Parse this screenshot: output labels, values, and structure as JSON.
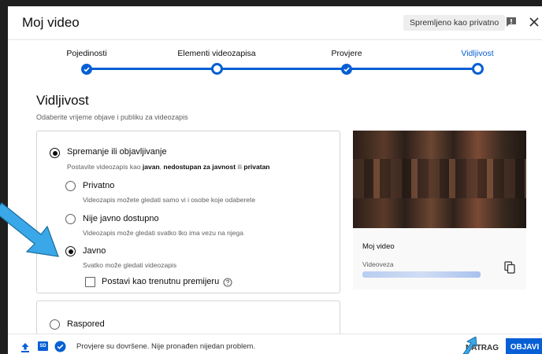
{
  "header": {
    "title": "Moj video",
    "saved_status": "Spremljeno kao privatno"
  },
  "steps": [
    {
      "label": "Pojedinosti",
      "state": "done"
    },
    {
      "label": "Elementi videozapisa",
      "state": "current"
    },
    {
      "label": "Provjere",
      "state": "done"
    },
    {
      "label": "Vidljivost",
      "state": "active"
    }
  ],
  "section": {
    "title": "Vidljivost",
    "subtitle": "Odaberite vrijeme objave i publiku za videozapis"
  },
  "save_publish": {
    "label": "Spremanje ili objavljivanje",
    "desc_parts": [
      "Postavite videozapis kao ",
      "javan",
      ", ",
      "nedostupan za javnost",
      " ili ",
      "privatan"
    ]
  },
  "options": [
    {
      "label": "Privatno",
      "desc": "Videozapis možete gledati samo vi i osobe koje odaberete",
      "selected": false
    },
    {
      "label": "Nije javno dostupno",
      "desc": "Videozapis može gledati svatko tko ima vezu na njega",
      "selected": false
    },
    {
      "label": "Javno",
      "desc": "Svatko može gledati videozapis",
      "selected": true
    }
  ],
  "premiere": {
    "label": "Postavi kao trenutnu premijeru",
    "checked": false
  },
  "schedule": {
    "label": "Raspored"
  },
  "preview": {
    "title": "Moj video",
    "link_label": "Videoveza"
  },
  "footer": {
    "hd_badge": "SD",
    "status": "Provjere su dovršene. Nije pronađen nijedan problem.",
    "back_label": "NATRAG",
    "publish_label": "OBJAVI"
  },
  "colors": {
    "accent": "#065fd4",
    "annotation_arrow": "#3aa8e8"
  }
}
